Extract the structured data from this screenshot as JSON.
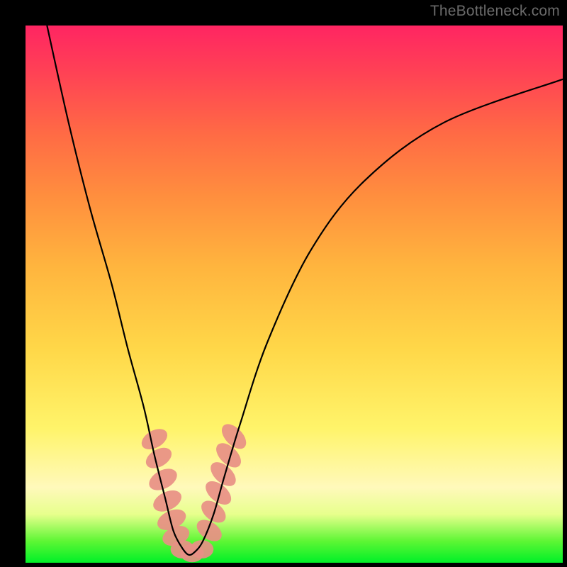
{
  "watermark": "TheBottleneck.com",
  "chart_data": {
    "type": "line",
    "title": "",
    "xlabel": "",
    "ylabel": "",
    "xlim": [
      0,
      100
    ],
    "ylim": [
      0,
      100
    ],
    "series": [
      {
        "name": "curve",
        "color": "#000000",
        "x": [
          4,
          8,
          12,
          16,
          19,
          22,
          24,
          26,
          27.5,
          29,
          30.3,
          31.5,
          33,
          35,
          37,
          40,
          45,
          53,
          63,
          78,
          100
        ],
        "values": [
          100,
          82,
          66,
          52,
          40,
          29,
          20,
          12,
          6,
          3,
          1.5,
          2,
          4,
          9,
          16,
          26,
          41,
          58,
          71,
          82,
          90
        ]
      }
    ],
    "markers": [
      {
        "name": "left-blobs",
        "color": "#e88f85",
        "points": [
          {
            "x": 24.0,
            "y": 23.0,
            "rx": 1.6,
            "ry": 2.6,
            "rot": 60
          },
          {
            "x": 24.8,
            "y": 19.5,
            "rx": 1.6,
            "ry": 2.6,
            "rot": 60
          },
          {
            "x": 25.6,
            "y": 15.5,
            "rx": 1.7,
            "ry": 2.8,
            "rot": 62
          },
          {
            "x": 26.4,
            "y": 11.5,
            "rx": 1.7,
            "ry": 2.8,
            "rot": 64
          },
          {
            "x": 27.2,
            "y": 8.0,
            "rx": 1.7,
            "ry": 2.8,
            "rot": 66
          },
          {
            "x": 28.0,
            "y": 5.0,
            "rx": 1.7,
            "ry": 2.6,
            "rot": 68
          }
        ]
      },
      {
        "name": "bottom-blobs",
        "color": "#e88f85",
        "points": [
          {
            "x": 29.2,
            "y": 2.5,
            "rx": 2.2,
            "ry": 1.7,
            "rot": 0
          },
          {
            "x": 31.0,
            "y": 1.8,
            "rx": 2.2,
            "ry": 1.7,
            "rot": 0
          },
          {
            "x": 32.8,
            "y": 2.5,
            "rx": 2.2,
            "ry": 1.7,
            "rot": 0
          }
        ]
      },
      {
        "name": "right-blobs",
        "color": "#e88f85",
        "points": [
          {
            "x": 34.2,
            "y": 6.0,
            "rx": 1.6,
            "ry": 2.6,
            "rot": -55
          },
          {
            "x": 35.0,
            "y": 9.5,
            "rx": 1.6,
            "ry": 2.6,
            "rot": -52
          },
          {
            "x": 35.9,
            "y": 13.0,
            "rx": 1.6,
            "ry": 2.8,
            "rot": -50
          },
          {
            "x": 36.8,
            "y": 16.5,
            "rx": 1.6,
            "ry": 2.8,
            "rot": -48
          },
          {
            "x": 37.8,
            "y": 20.0,
            "rx": 1.6,
            "ry": 2.8,
            "rot": -46
          },
          {
            "x": 38.8,
            "y": 23.5,
            "rx": 1.6,
            "ry": 2.8,
            "rot": -44
          }
        ]
      }
    ]
  }
}
